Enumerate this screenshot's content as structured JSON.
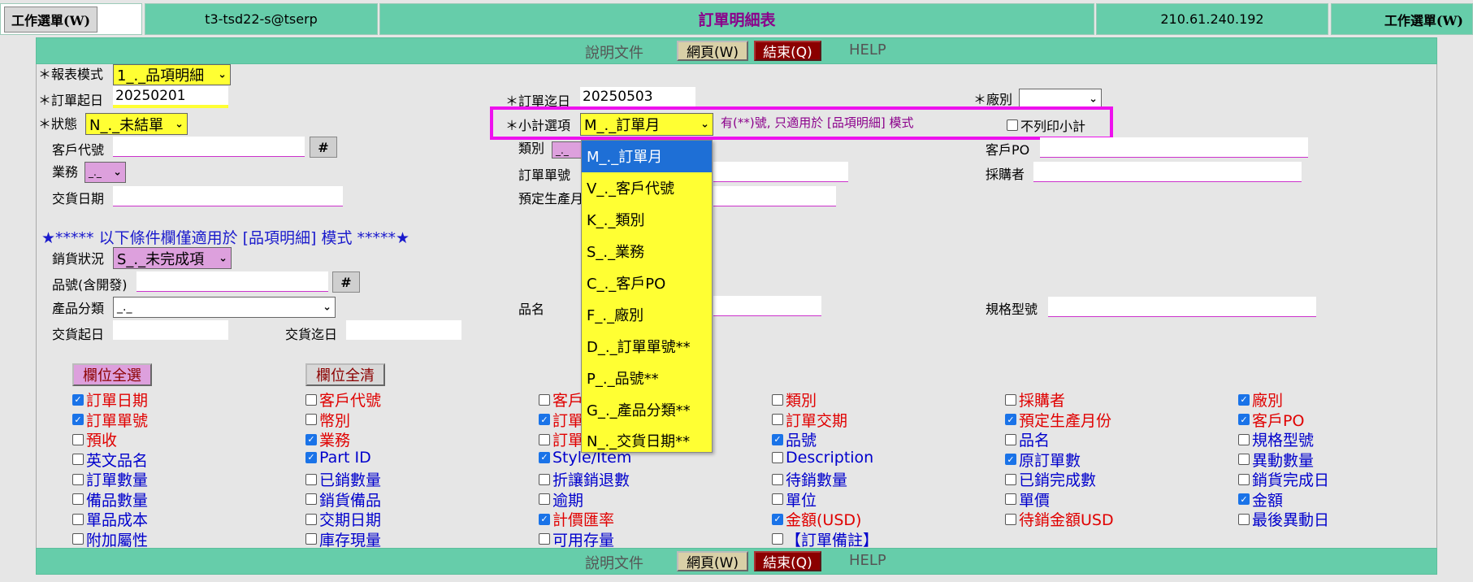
{
  "topbar": {
    "left_menu": "工作選單(W)",
    "user": "t3-tsd22-s@tserp",
    "title": "訂單明細表",
    "ip": "210.61.240.192",
    "right_menu": "工作選單(W)"
  },
  "strip": {
    "doc": "說明文件",
    "web": "網頁(W)",
    "quit": "結束(Q)",
    "help": "HELP"
  },
  "form": {
    "report_mode_label": "＊報表模式",
    "report_mode_value": "1_._品項明細",
    "order_start_label": "＊訂單起日",
    "order_start_value": "20250201",
    "order_end_label": "＊訂單迄日",
    "order_end_value": "20250503",
    "factory_label": "＊廠別",
    "status_label": "＊狀態",
    "status_value": "N_._未結單",
    "subtotal_label": "＊小計選項",
    "subtotal_value": "M_._訂單月",
    "subtotal_note": "有(**)號, 只適用於 [品項明細] 模式",
    "no_print_subtotal": "不列印小計",
    "customer_code_label": "客戶代號",
    "category_label": "類別",
    "category_value": "_._",
    "customer_po_label": "客戶PO",
    "sales_label": "業務",
    "sales_value": "_._",
    "order_no_label": "訂單單號",
    "buyer_label": "採購者",
    "delivery_date_label": "交貨日期",
    "planned_prod_label": "預定生產月",
    "hash": "#",
    "section_note": "★***** 以下條件欄僅適用於 [品項明細] 模式 *****★",
    "sales_status_label": "銷貨狀況",
    "sales_status_value": "S_._未完成項",
    "part_no_label": "品號(含開發)",
    "product_cat_label": "產品分類",
    "product_cat_value": "_._",
    "product_name_label": "品名",
    "spec_label": "規格型號",
    "delivery_start_label": "交貨起日",
    "delivery_end_label": "交貨迄日"
  },
  "dropdown": {
    "options": [
      "M_._訂單月",
      "V_._客戶代號",
      "K_._類別",
      "S_._業務",
      "C_._客戶PO",
      "F_._廠別",
      "D_._訂單單號**",
      "P_._品號**",
      "G_._產品分類**",
      "N_._交貨日期**"
    ]
  },
  "buttons": {
    "select_all": "欄位全選",
    "clear_all": "欄位全清"
  },
  "columns": {
    "c1": [
      {
        "label": "訂單日期",
        "checked": true,
        "color": "#e00000"
      },
      {
        "label": "訂單單號",
        "checked": true,
        "color": "#e00000"
      },
      {
        "label": "預收",
        "checked": false,
        "color": "#e00000"
      },
      {
        "label": "英文品名",
        "checked": false,
        "color": "#0000cc"
      },
      {
        "label": "訂單數量",
        "checked": false,
        "color": "#0000cc"
      },
      {
        "label": "備品數量",
        "checked": false,
        "color": "#0000cc"
      },
      {
        "label": "單品成本",
        "checked": false,
        "color": "#0000cc"
      },
      {
        "label": "附加屬性",
        "checked": false,
        "color": "#0000cc"
      }
    ],
    "c2": [
      {
        "label": "客戶代號",
        "checked": false,
        "color": "#e00000"
      },
      {
        "label": "幣別",
        "checked": false,
        "color": "#e00000"
      },
      {
        "label": "業務",
        "checked": true,
        "color": "#e00000"
      },
      {
        "label": "Part ID",
        "checked": true,
        "color": "#0000cc"
      },
      {
        "label": "已銷數量",
        "checked": false,
        "color": "#0000cc"
      },
      {
        "label": "銷貨備品",
        "checked": false,
        "color": "#0000cc"
      },
      {
        "label": "交期日期",
        "checked": false,
        "color": "#0000cc"
      },
      {
        "label": "庫存現量",
        "checked": false,
        "color": "#0000cc"
      }
    ],
    "c3": [
      {
        "label": "客戶",
        "checked": false,
        "color": "#e00000"
      },
      {
        "label": "訂單",
        "checked": true,
        "color": "#e00000"
      },
      {
        "label": "訂單",
        "checked": false,
        "color": "#e00000"
      },
      {
        "label": "Style/Item",
        "checked": true,
        "color": "#0000cc"
      },
      {
        "label": "折讓銷退數",
        "checked": false,
        "color": "#0000cc"
      },
      {
        "label": "逾期",
        "checked": false,
        "color": "#0000cc"
      },
      {
        "label": "計價匯率",
        "checked": true,
        "color": "#e00000"
      },
      {
        "label": "可用存量",
        "checked": false,
        "color": "#0000cc"
      }
    ],
    "c4": [
      {
        "label": "類別",
        "checked": false,
        "color": "#e00000"
      },
      {
        "label": "訂單交期",
        "checked": false,
        "color": "#e00000"
      },
      {
        "label": "品號",
        "checked": true,
        "color": "#0000cc"
      },
      {
        "label": "Description",
        "checked": false,
        "color": "#0000cc"
      },
      {
        "label": "待銷數量",
        "checked": false,
        "color": "#0000cc"
      },
      {
        "label": "單位",
        "checked": false,
        "color": "#0000cc"
      },
      {
        "label": "金額(USD)",
        "checked": true,
        "color": "#e00000"
      },
      {
        "label": "【訂單備註】",
        "checked": false,
        "color": "#0000cc"
      }
    ],
    "c5": [
      {
        "label": "採購者",
        "checked": false,
        "color": "#e00000"
      },
      {
        "label": "預定生產月份",
        "checked": true,
        "color": "#e00000"
      },
      {
        "label": "品名",
        "checked": false,
        "color": "#0000cc"
      },
      {
        "label": "原訂單數",
        "checked": true,
        "color": "#0000cc"
      },
      {
        "label": "已銷完成數",
        "checked": false,
        "color": "#0000cc"
      },
      {
        "label": "單價",
        "checked": false,
        "color": "#0000cc"
      },
      {
        "label": "待銷金額USD",
        "checked": false,
        "color": "#e00000"
      }
    ],
    "c6": [
      {
        "label": "廠別",
        "checked": true,
        "color": "#e00000"
      },
      {
        "label": "客戶PO",
        "checked": true,
        "color": "#e00000"
      },
      {
        "label": "規格型號",
        "checked": false,
        "color": "#0000cc"
      },
      {
        "label": "異動數量",
        "checked": false,
        "color": "#0000cc"
      },
      {
        "label": "銷貨完成日",
        "checked": false,
        "color": "#0000cc"
      },
      {
        "label": "金額",
        "checked": true,
        "color": "#0000cc"
      },
      {
        "label": "最後異動日",
        "checked": false,
        "color": "#0000cc"
      }
    ]
  }
}
